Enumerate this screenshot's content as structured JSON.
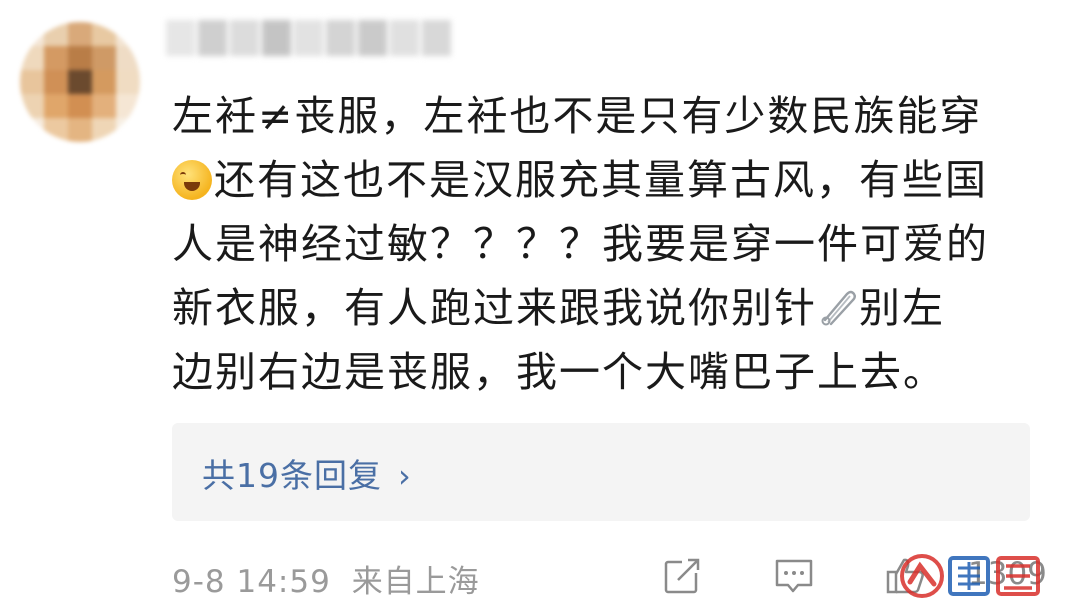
{
  "comment": {
    "text_lines": [
      "左衽≠丧服，左衽也不是只有少数民族能穿",
      "还有这也不是汉服充其量算古风，有些国",
      "人是神经过敏？？？？我要是穿一件可爱的",
      "新衣服，有人跑过来跟我说你别针",
      "别左",
      "边别右边是丧服，我一个大嘴巴子上去。"
    ],
    "emoji_icons": [
      "grinning-face-icon",
      "safety-pin-icon"
    ]
  },
  "replies": {
    "label": "共19条回复",
    "chevron": "›"
  },
  "footer": {
    "timestamp": "9-8 14:59",
    "location": "来自上海",
    "like_count": "1309",
    "icons": [
      "share-icon",
      "comment-icon",
      "like-icon"
    ]
  },
  "colors": {
    "text": "#1a1a1a",
    "link": "#4a6fa5",
    "meta": "#9a9a9a",
    "reply_bg": "#f4f4f4",
    "watermark_red": "#d9302b",
    "watermark_blue": "#1f5fb3"
  }
}
